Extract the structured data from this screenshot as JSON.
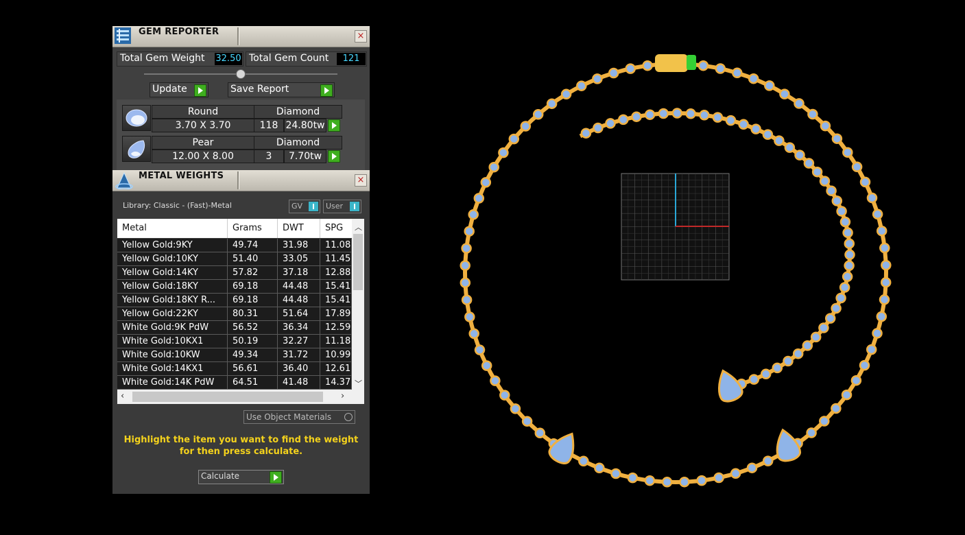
{
  "gem_reporter": {
    "title": "GEM REPORTER",
    "close": "×",
    "total_weight_label": "Total Gem Weight",
    "total_weight_value": "32.50",
    "total_count_label": "Total Gem Count",
    "total_count_value": "121",
    "update_label": "Update",
    "save_report_label": "Save Report",
    "gems": [
      {
        "shape": "Round",
        "material": "Diamond",
        "size": "3.70 X 3.70",
        "count": "118",
        "weight": "24.80tw"
      },
      {
        "shape": "Pear",
        "material": "Diamond",
        "size": "12.00 X 8.00",
        "count": "3",
        "weight": "7.70tw"
      }
    ]
  },
  "metal_weights": {
    "title": "METAL WEIGHTS",
    "close": "×",
    "library": "Library: Classic - (Fast)-Metal",
    "gv_label": "GV",
    "user_label": "User",
    "columns": [
      "Metal",
      "Grams",
      "DWT",
      "SPG"
    ],
    "rows": [
      [
        "Yellow Gold:9KY",
        "49.74",
        "31.98",
        "11.08"
      ],
      [
        "Yellow Gold:10KY",
        "51.40",
        "33.05",
        "11.45"
      ],
      [
        "Yellow Gold:14KY",
        "57.82",
        "37.18",
        "12.88"
      ],
      [
        "Yellow Gold:18KY",
        "69.18",
        "44.48",
        "15.41"
      ],
      [
        "Yellow Gold:18KY R...",
        "69.18",
        "44.48",
        "15.41"
      ],
      [
        "Yellow Gold:22KY",
        "80.31",
        "51.64",
        "17.89"
      ],
      [
        "White Gold:9K PdW",
        "56.52",
        "36.34",
        "12.59"
      ],
      [
        "White Gold:10KX1",
        "50.19",
        "32.27",
        "11.18"
      ],
      [
        "White Gold:10KW",
        "49.34",
        "31.72",
        "10.99"
      ],
      [
        "White Gold:14KX1",
        "56.61",
        "36.40",
        "12.61"
      ],
      [
        "White Gold:14K PdW",
        "64.51",
        "41.48",
        "14.37"
      ]
    ],
    "use_object_materials": "Use Object Materials",
    "hint_line1": "Highlight the item you want to find the weight",
    "hint_line2": "for then press calculate.",
    "calculate_label": "Calculate"
  },
  "viewport": {
    "metal_color": "#f0b040",
    "gem_color": "#8fb4e8",
    "clasp_color": "#f2c24a",
    "clasp_tip_color": "#35d035"
  }
}
